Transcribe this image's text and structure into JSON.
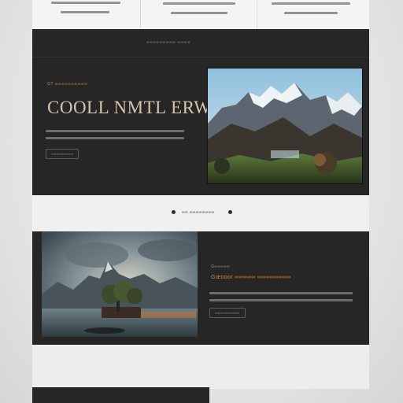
{
  "feature_cards": [
    {
      "lines": [
        "",
        ""
      ]
    },
    {
      "lines": [
        "",
        ""
      ]
    },
    {
      "lines": [
        "",
        ""
      ]
    }
  ],
  "nav": {
    "text": "∞∞∞∞∞∞∞∞∞ ∞∞∞∞"
  },
  "hero": {
    "eyebrow": "Ω? ∞∞∞∞∞∞∞∞∞∞",
    "title": "COOLL NMTL ERWER.",
    "cta_label": "∞∞∞∞∞∞∞∞∞"
  },
  "pager": {
    "label": "∞∞ ∞∞∞∞∞∞∞∞"
  },
  "feature": {
    "eyebrow": "Ω∞∞∞∞∞",
    "title": "Gœooor ∞∞∞∞∞ ∞∞∞∞∞∞∞∞",
    "cta_label": "∞∞∞∞∞∞∞∞∞∞"
  },
  "colors": {
    "dark_bg": "#262626",
    "accent": "#c98a4e",
    "light_bg": "#f0f0f0"
  }
}
